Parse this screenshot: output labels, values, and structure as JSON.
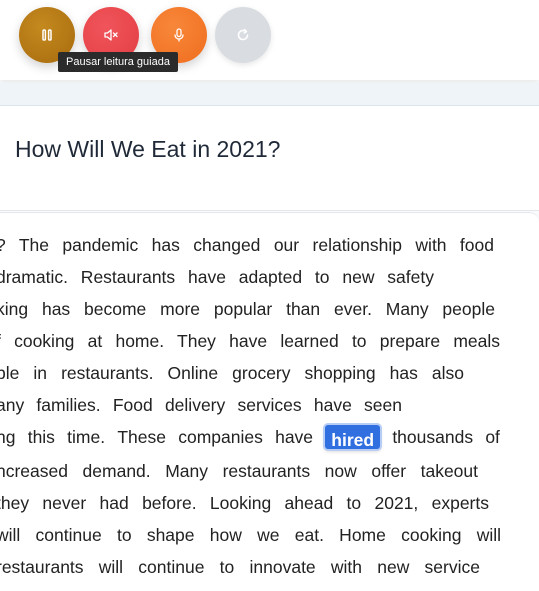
{
  "toolbar": {
    "buttons": [
      {
        "name": "pause",
        "icon": "pause-icon",
        "color": "#b57914"
      },
      {
        "name": "mute",
        "icon": "speaker-muted-icon",
        "color": "#e5484d"
      },
      {
        "name": "microphone",
        "icon": "microphone-icon",
        "color": "#f47a2a"
      },
      {
        "name": "reset",
        "icon": "refresh-icon",
        "color": "#d9dde2"
      }
    ],
    "tooltip": "Pausar leitura guiada"
  },
  "article": {
    "title": "How Will We Eat in 2021?",
    "lines": [
      "? The pandemic has changed our relationship with food",
      "dramatic. Restaurants have adapted to new safety",
      "king has become more popular than ever. Many people",
      "f cooking at home. They have learned to prepare meals",
      "ble in restaurants. Online grocery shopping has also",
      "any families. Food delivery services have seen",
      "ncreased demand. Many restaurants now offer takeout",
      "they never had before. Looking ahead to 2021, experts",
      " will continue to shape how we eat. Home cooking will",
      " restaurants will continue to innovate with new service"
    ],
    "highlight_line": {
      "before_words": [
        "ng",
        "this",
        "time.",
        "These",
        "companies",
        "have"
      ],
      "highlighted_word": "hired",
      "after_words": [
        "thousands",
        "of"
      ]
    },
    "highlight_color": "#2f6fe0"
  }
}
